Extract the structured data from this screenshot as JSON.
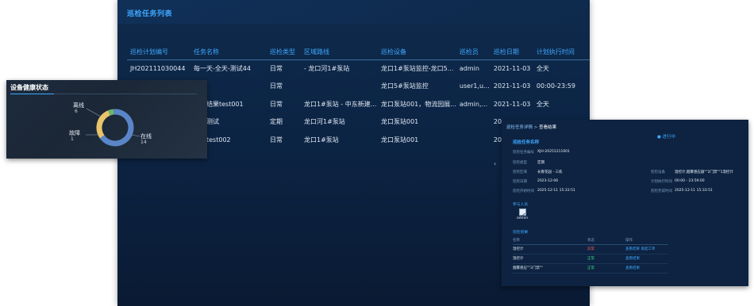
{
  "main": {
    "title": "巡检任务列表",
    "columns": [
      "巡检计划编号",
      "任务名称",
      "巡检类型",
      "区域路线",
      "巡检设备",
      "巡检员",
      "巡检日期",
      "计划执行时间"
    ],
    "rows": [
      [
        "JH202111030044",
        "每一天-全天-测试44",
        "日常",
        "- 龙口河1#泵站",
        "龙口1#泵站监控-龙口5...",
        "admin",
        "2021-11-03",
        "全天"
      ],
      [
        "",
        "厂",
        "日常",
        "",
        "龙口5#泵站监控",
        "user1,u...",
        "2021-11-03",
        "00:00-23:59"
      ],
      [
        "",
        "上传结果test001",
        "日常",
        "龙口1#泵站 - 中东新建...",
        "龙口泵站001，物流园展...",
        "admin,...",
        "2021-11-03",
        "全天"
      ],
      [
        "",
        "巡检测试",
        "定期",
        "龙口河1#泵站",
        "龙口泵站001",
        "",
        "20",
        ""
      ],
      [
        "",
        "巡检test002",
        "日常",
        "龙口1#泵站",
        "龙口泵站001",
        "",
        "20",
        ""
      ]
    ]
  },
  "health": {
    "title": "设备健康状态",
    "segments": [
      {
        "label": "离线",
        "value": 6,
        "color": "#e9c46a"
      },
      {
        "label": "故障",
        "value": 1,
        "color": "#67b86b"
      },
      {
        "label": "在线",
        "value": 14,
        "color": "#5a86c9"
      }
    ]
  },
  "detail": {
    "breadcrumb_parent": "巡检任务详情",
    "breadcrumb_sep": ">",
    "breadcrumb_current": "查看结果",
    "status": "● 进行中",
    "section_info": "巡检任务名称",
    "fields": {
      "plan_no_key": "巡检任务编号",
      "plan_no": "XJH-20251211001",
      "type_key": "巡检类型",
      "type": "定期",
      "area_key": "巡检区域",
      "area": "长春花园 - 三栋",
      "device_key": "巡检设备",
      "device": "温控计,烟雾感应器\"\"2门禁\"\"1温控计",
      "date_key": "巡检日期",
      "date": "2023-12-06",
      "plan_time_key": "计划执行时间",
      "plan_time": "00:00 - 23:59:00",
      "start_key": "巡检开始时间",
      "start": "2025-12-11 15:33:51",
      "end_key": "巡检完成时间",
      "end": "2025-12-11 15:33:51"
    },
    "section_people": "参与人员",
    "person": "admin",
    "section_results": "巡检结果",
    "result_columns": [
      "名称",
      "状态",
      "操作"
    ],
    "results": [
      {
        "name": "温控计",
        "status": "异常",
        "status_class": "red",
        "action": "查看结果  发起工单"
      },
      {
        "name": "温控计",
        "status": "正常",
        "status_class": "green",
        "action": "查看结果"
      },
      {
        "name": "烟雾感应\"\"2门禁\"\"",
        "status": "正常",
        "status_class": "green",
        "action": "查看结果"
      }
    ]
  }
}
